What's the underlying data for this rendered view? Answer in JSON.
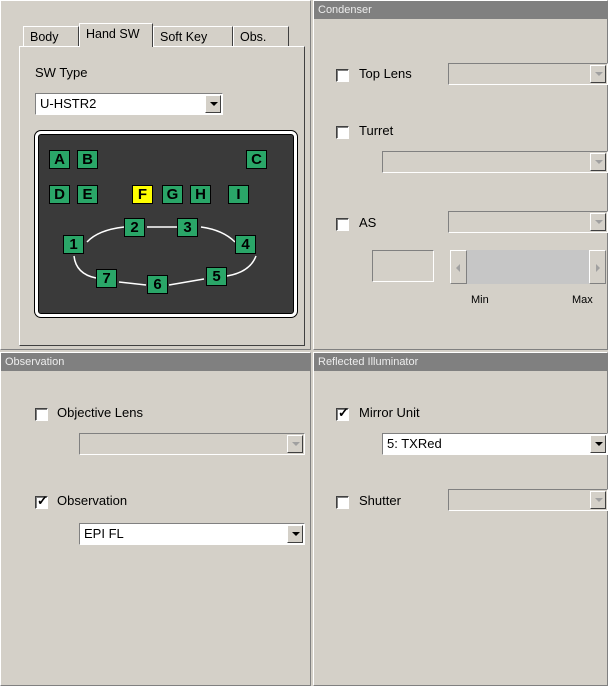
{
  "tabs": [
    "Body",
    "Hand SW",
    "Soft Key",
    "Obs."
  ],
  "sw_type": {
    "label": "SW Type",
    "value": "U-HSTR2"
  },
  "keys": {
    "row1": [
      "A",
      "B",
      "C"
    ],
    "row2": [
      "D",
      "E",
      "F",
      "G",
      "H",
      "I"
    ],
    "circle": [
      "1",
      "2",
      "3",
      "4",
      "5",
      "6",
      "7"
    ],
    "highlighted": "F"
  },
  "condenser": {
    "title": "Condenser",
    "top_lens": "Top Lens",
    "turret": "Turret",
    "as": "AS",
    "slider_min": "Min",
    "slider_max": "Max"
  },
  "observation": {
    "title": "Observation",
    "objective_lens": "Objective Lens",
    "observation_label": "Observation",
    "observation_value": "EPI FL",
    "observation_checked": true
  },
  "reflected": {
    "title": "Reflected Illuminator",
    "mirror_unit": "Mirror Unit",
    "mirror_value": "5: TXRed",
    "mirror_checked": true,
    "shutter": "Shutter"
  },
  "colors": {
    "key_green": "#2aa668",
    "key_highlight": "#ffff00",
    "panel_title": "#808080"
  }
}
